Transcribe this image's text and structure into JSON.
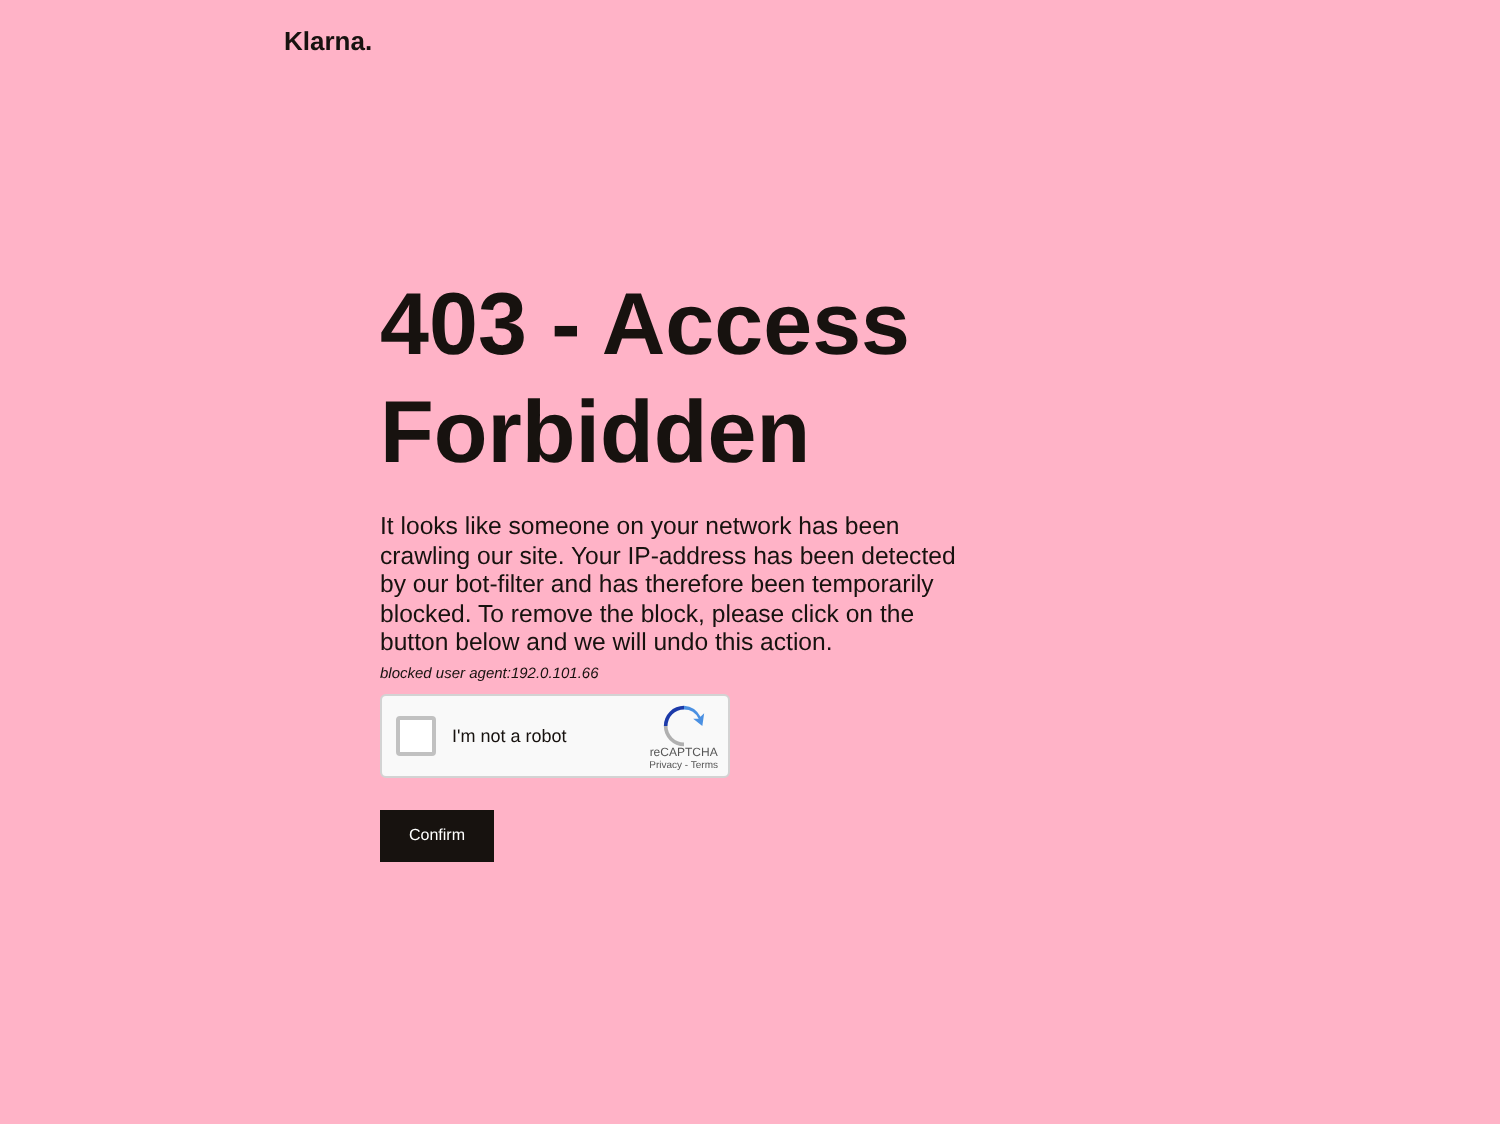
{
  "logo": "Klarna.",
  "heading": "403 - Access Forbidden",
  "message": "It looks like someone on your network has been crawling our site. Your IP-address has been detected by our bot-filter and has therefore been temporarily blocked. To remove the block, please click on the button below and we will undo this action.",
  "blocked_info": "blocked user agent:192.0.101.66",
  "captcha": {
    "label": "I'm not a robot",
    "checked": false,
    "brand": "reCAPTCHA",
    "links": "Privacy - Terms"
  },
  "button": "Confirm"
}
